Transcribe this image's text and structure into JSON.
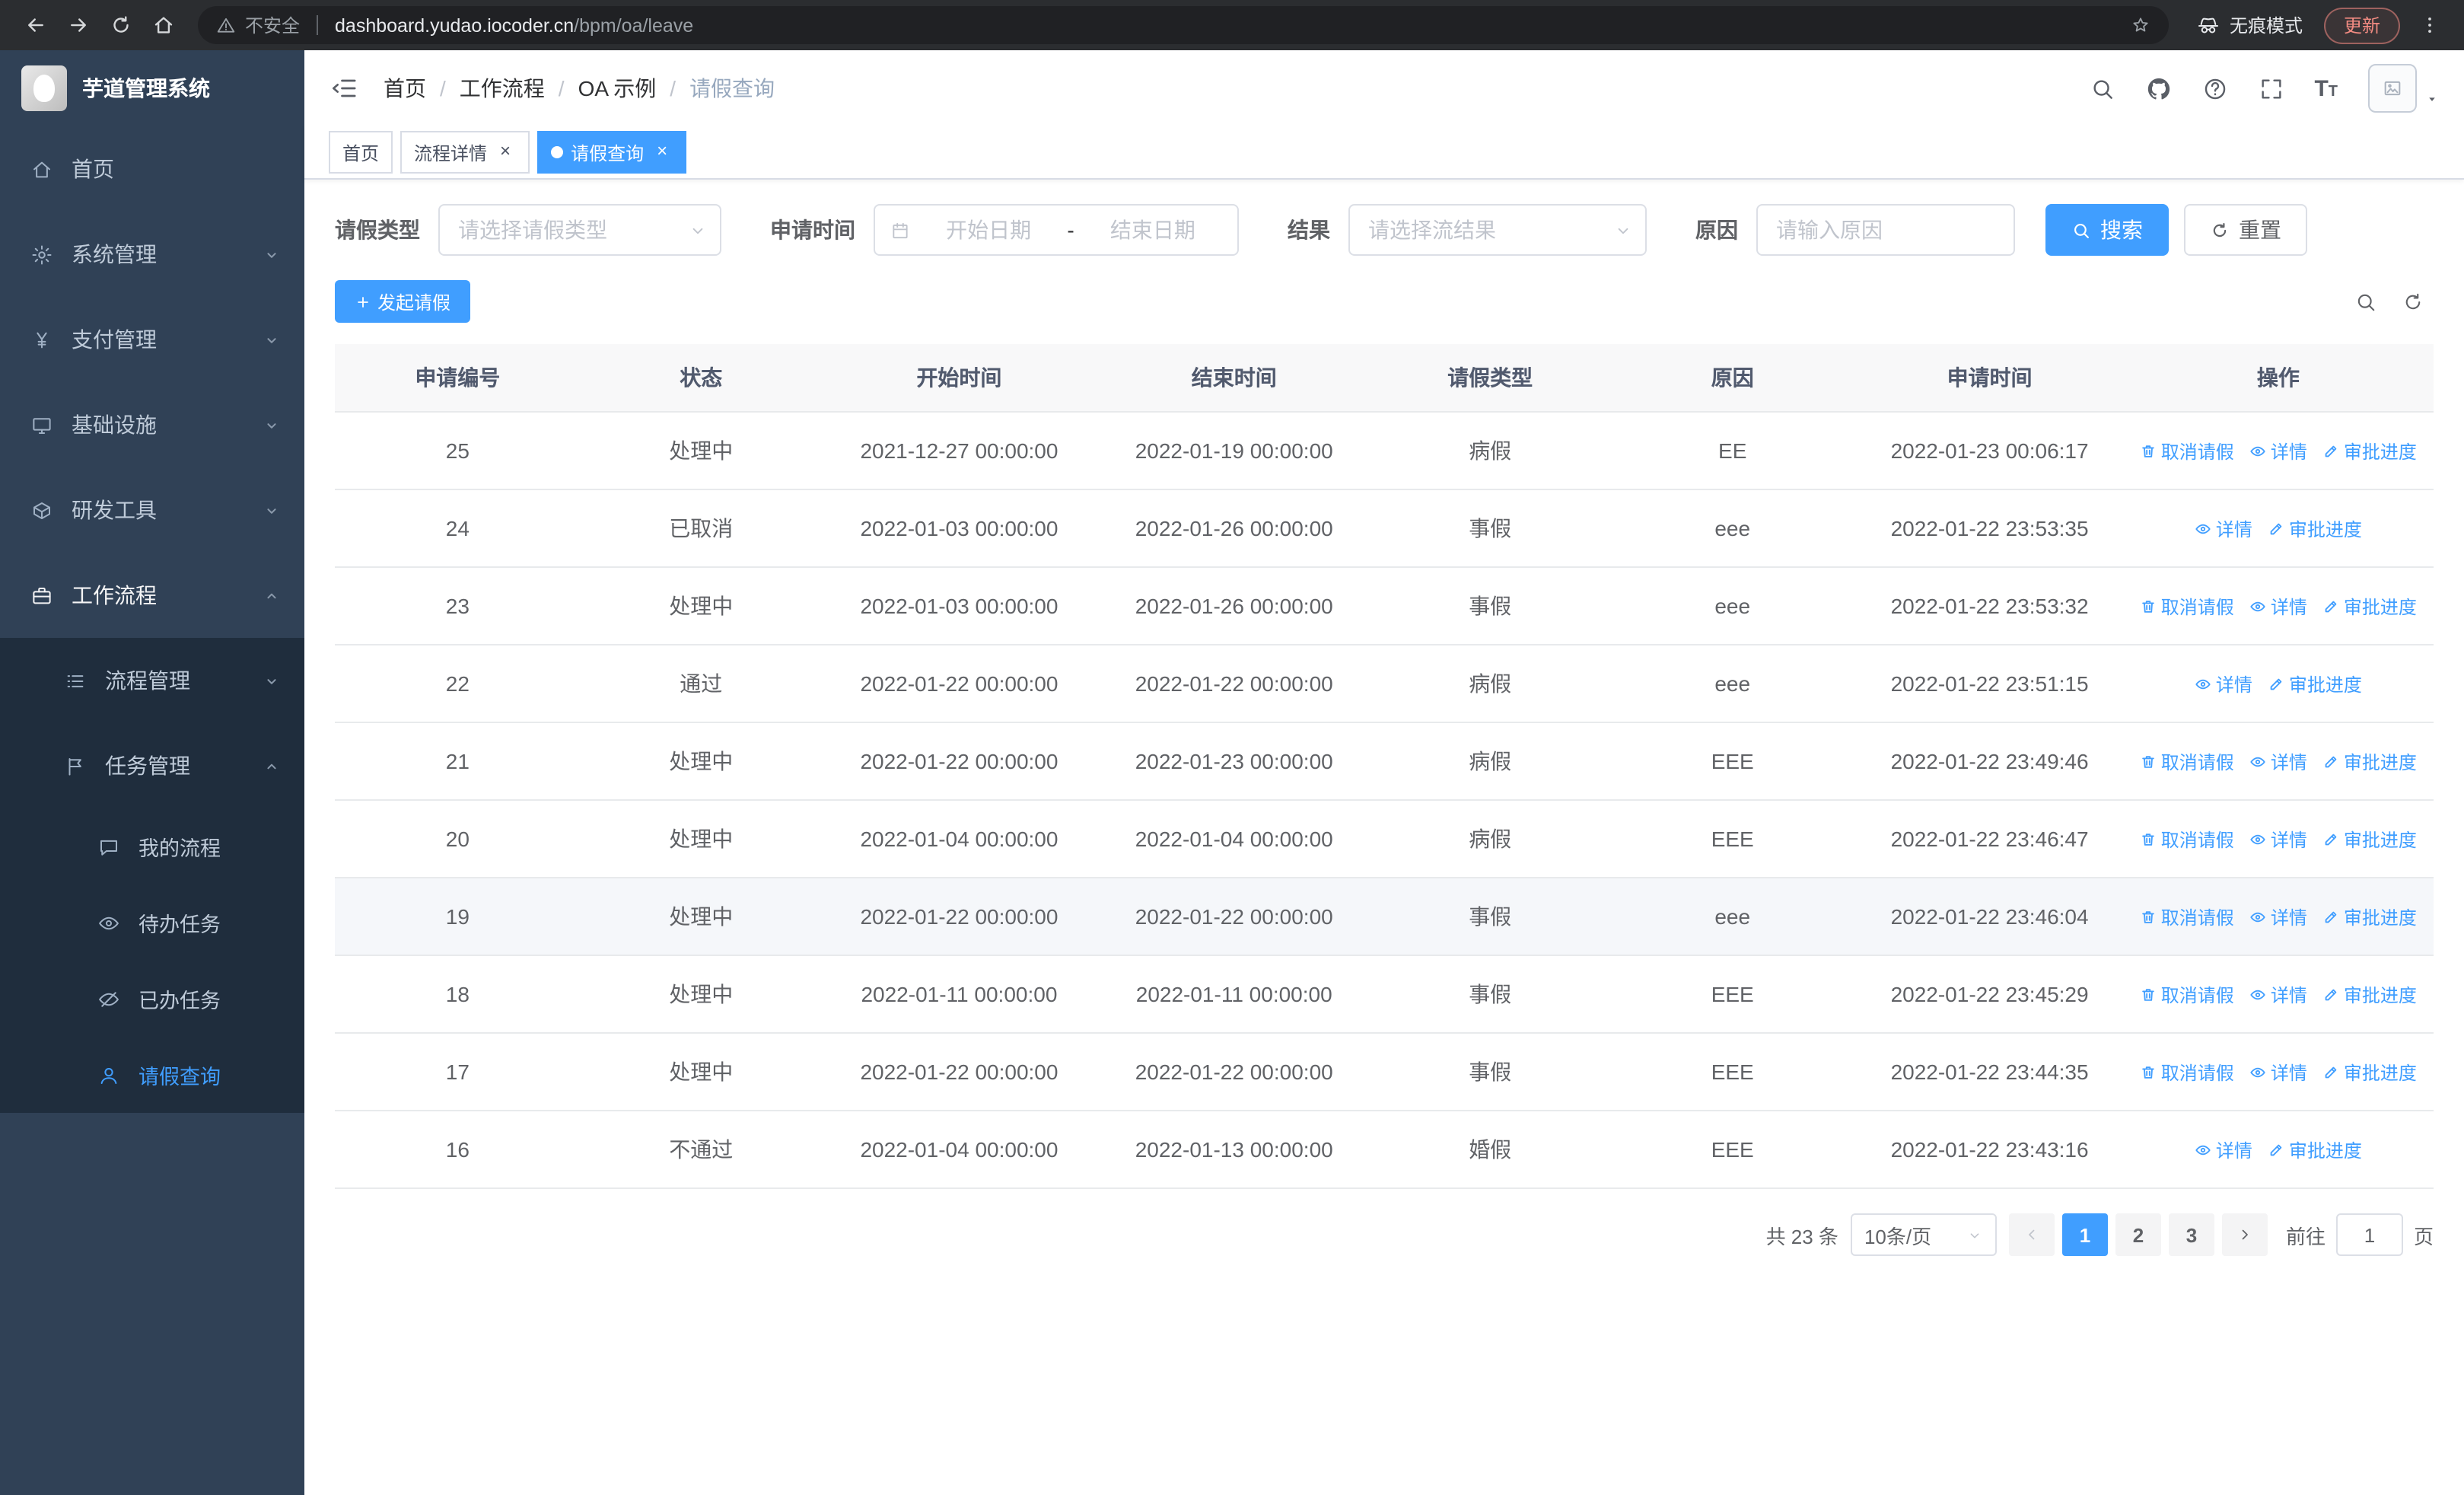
{
  "browser": {
    "security_label": "不安全",
    "url_domain": "dashboard.yudao.iocoder.cn",
    "url_path": "/bpm/oa/leave",
    "incognito_label": "无痕模式",
    "update_label": "更新"
  },
  "sidebar": {
    "title": "芋道管理系统",
    "items": [
      {
        "name": "home",
        "label": "首页",
        "icon": "home",
        "level": 1
      },
      {
        "name": "system-management",
        "label": "系统管理",
        "icon": "gear",
        "level": 1,
        "chevron": "down"
      },
      {
        "name": "payment-management",
        "label": "支付管理",
        "icon": "yen",
        "level": 1,
        "chevron": "down"
      },
      {
        "name": "infrastructure",
        "label": "基础设施",
        "icon": "monitor",
        "level": 1,
        "chevron": "down"
      },
      {
        "name": "dev-tools",
        "label": "研发工具",
        "icon": "box",
        "level": 1,
        "chevron": "down"
      },
      {
        "name": "workflow",
        "label": "工作流程",
        "icon": "briefcase",
        "level": 1,
        "chevron": "up",
        "parent_active": true
      },
      {
        "name": "process-management",
        "label": "流程管理",
        "icon": "list",
        "level": 2,
        "chevron": "down"
      },
      {
        "name": "task-management",
        "label": "任务管理",
        "icon": "flag",
        "level": 2,
        "chevron": "up"
      },
      {
        "name": "my-process",
        "label": "我的流程",
        "icon": "chat",
        "level": 3
      },
      {
        "name": "todo-tasks",
        "label": "待办任务",
        "icon": "eye",
        "level": 3
      },
      {
        "name": "done-tasks",
        "label": "已办任务",
        "icon": "eyeoff",
        "level": 3
      },
      {
        "name": "leave-query",
        "label": "请假查询",
        "icon": "user",
        "level": 3,
        "active": true
      }
    ]
  },
  "header": {
    "breadcrumbs": [
      "首页",
      "工作流程",
      "OA 示例",
      "请假查询"
    ],
    "breadcrumb_separator": "/"
  },
  "tabs": [
    {
      "name": "home",
      "label": "首页",
      "closable": false,
      "active": false
    },
    {
      "name": "process-detail",
      "label": "流程详情",
      "closable": true,
      "active": false
    },
    {
      "name": "leave-query",
      "label": "请假查询",
      "closable": true,
      "active": true
    }
  ],
  "filters": {
    "leave_type_label": "请假类型",
    "leave_type_placeholder": "请选择请假类型",
    "apply_time_label": "申请时间",
    "start_date_placeholder": "开始日期",
    "range_separator": "-",
    "end_date_placeholder": "结束日期",
    "result_label": "结果",
    "result_placeholder": "请选择流结果",
    "reason_label": "原因",
    "reason_placeholder": "请输入原因",
    "search_label": "搜索",
    "reset_label": "重置"
  },
  "toolbar": {
    "create_label": "发起请假"
  },
  "table": {
    "columns": [
      "申请编号",
      "状态",
      "开始时间",
      "结束时间",
      "请假类型",
      "原因",
      "申请时间",
      "操作"
    ],
    "op_labels": {
      "cancel": "取消请假",
      "detail": "详情",
      "progress": "审批进度"
    },
    "rows": [
      {
        "id": "25",
        "status": "处理中",
        "start_time": "2021-12-27 00:00:00",
        "end_time": "2022-01-19 00:00:00",
        "leave_type": "病假",
        "reason": "EE",
        "apply_time": "2022-01-23 00:06:17",
        "ops": [
          "cancel",
          "detail",
          "progress"
        ]
      },
      {
        "id": "24",
        "status": "已取消",
        "start_time": "2022-01-03 00:00:00",
        "end_time": "2022-01-26 00:00:00",
        "leave_type": "事假",
        "reason": "eee",
        "apply_time": "2022-01-22 23:53:35",
        "ops": [
          "detail",
          "progress"
        ]
      },
      {
        "id": "23",
        "status": "处理中",
        "start_time": "2022-01-03 00:00:00",
        "end_time": "2022-01-26 00:00:00",
        "leave_type": "事假",
        "reason": "eee",
        "apply_time": "2022-01-22 23:53:32",
        "ops": [
          "cancel",
          "detail",
          "progress"
        ]
      },
      {
        "id": "22",
        "status": "通过",
        "start_time": "2022-01-22 00:00:00",
        "end_time": "2022-01-22 00:00:00",
        "leave_type": "病假",
        "reason": "eee",
        "apply_time": "2022-01-22 23:51:15",
        "ops": [
          "detail",
          "progress"
        ]
      },
      {
        "id": "21",
        "status": "处理中",
        "start_time": "2022-01-22 00:00:00",
        "end_time": "2022-01-23 00:00:00",
        "leave_type": "病假",
        "reason": "EEE",
        "apply_time": "2022-01-22 23:49:46",
        "ops": [
          "cancel",
          "detail",
          "progress"
        ]
      },
      {
        "id": "20",
        "status": "处理中",
        "start_time": "2022-01-04 00:00:00",
        "end_time": "2022-01-04 00:00:00",
        "leave_type": "病假",
        "reason": "EEE",
        "apply_time": "2022-01-22 23:46:47",
        "ops": [
          "cancel",
          "detail",
          "progress"
        ]
      },
      {
        "id": "19",
        "status": "处理中",
        "start_time": "2022-01-22 00:00:00",
        "end_time": "2022-01-22 00:00:00",
        "leave_type": "事假",
        "reason": "eee",
        "apply_time": "2022-01-22 23:46:04",
        "ops": [
          "cancel",
          "detail",
          "progress"
        ],
        "highlighted": true
      },
      {
        "id": "18",
        "status": "处理中",
        "start_time": "2022-01-11 00:00:00",
        "end_time": "2022-01-11 00:00:00",
        "leave_type": "事假",
        "reason": "EEE",
        "apply_time": "2022-01-22 23:45:29",
        "ops": [
          "cancel",
          "detail",
          "progress"
        ]
      },
      {
        "id": "17",
        "status": "处理中",
        "start_time": "2022-01-22 00:00:00",
        "end_time": "2022-01-22 00:00:00",
        "leave_type": "事假",
        "reason": "EEE",
        "apply_time": "2022-01-22 23:44:35",
        "ops": [
          "cancel",
          "detail",
          "progress"
        ]
      },
      {
        "id": "16",
        "status": "不通过",
        "start_time": "2022-01-04 00:00:00",
        "end_time": "2022-01-13 00:00:00",
        "leave_type": "婚假",
        "reason": "EEE",
        "apply_time": "2022-01-22 23:43:16",
        "ops": [
          "detail",
          "progress"
        ]
      }
    ]
  },
  "pagination": {
    "total_label": "共 23 条",
    "page_size_label": "10条/页",
    "pages": [
      "1",
      "2",
      "3"
    ],
    "active_page": "1",
    "goto_label": "前往",
    "goto_value": "1",
    "unit_label": "页"
  }
}
